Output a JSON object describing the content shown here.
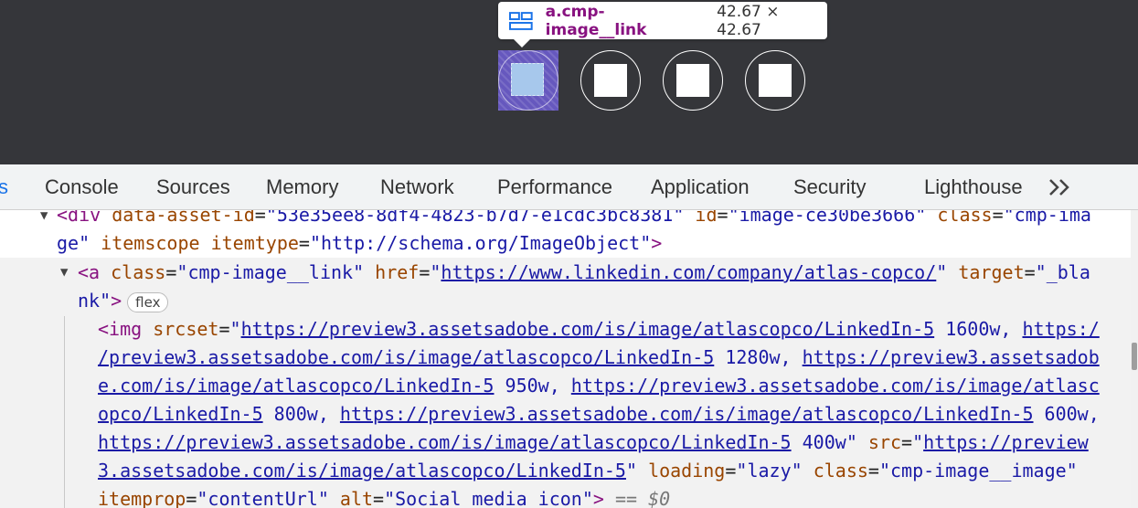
{
  "tooltip": {
    "selector": "a.cmp-image__link",
    "size": "42.67 × 42.67",
    "icon": "flex-layout-icon"
  },
  "preview": {
    "icons": [
      "linkedin-icon",
      "social-icon-2",
      "social-icon-3",
      "social-icon-4"
    ]
  },
  "tabs": {
    "partial": "s",
    "console": "Console",
    "sources": "Sources",
    "memory": "Memory",
    "network": "Network",
    "performance": "Performance",
    "application": "Application",
    "security": "Security",
    "lighthouse": "Lighthouse",
    "more": ">>"
  },
  "tree": {
    "l1": {
      "open": "<div",
      "a1n": "data-asset-id",
      "a1v": "\"53e35ee8-8df4-4823-b7d7-e1cdc3bc8381\"",
      "a2n": "id",
      "a2v": "\"image-ce30be3666\"",
      "a3n": "class",
      "a3v": "\"cmp-ima"
    },
    "l2": {
      "a3v_cont": "ge\"",
      "a4n": "itemscope",
      "a5n": "itemtype",
      "a5q1": "\"",
      "a5v": "http://schema.org/ImageObject",
      "a5q2": "\"",
      "close": ">"
    },
    "l3": {
      "open": "<a",
      "a1n": "class",
      "a1v": "\"cmp-image__link\"",
      "a2n": "href",
      "a2q1": "\"",
      "a2v": "https://www.linkedin.com/company/atlas-copco/",
      "a2q2": "\"",
      "a3n": "target",
      "a3v": "\"_bla"
    },
    "l4": {
      "a3v_cont": "nk\"",
      "close": ">",
      "badge": "flex"
    },
    "l5": {
      "open": "<img",
      "a1n": "srcset",
      "q": "\"",
      "link1": "https://preview3.assetsadobe.com/is/image/atlascopco/LinkedIn-5",
      "w1": " 1600w, ",
      "link2a": "https:/"
    },
    "l6": {
      "link2b": "/preview3.assetsadobe.com/is/image/atlascopco/LinkedIn-5",
      "w2": " 1280w, ",
      "link3a": "https://preview3.assetsadob"
    },
    "l7": {
      "link3b": "e.com/is/image/atlascopco/LinkedIn-5",
      "w3": " 950w, ",
      "link4a": "https://preview3.assetsadobe.com/is/image/atlasc"
    },
    "l8": {
      "link4b": "opco/LinkedIn-5",
      "w4": " 800w, ",
      "link5": "https://preview3.assetsadobe.com/is/image/atlascopco/LinkedIn-5",
      "w5": " 600w,"
    },
    "l9": {
      "link6": "https://preview3.assetsadobe.com/is/image/atlascopco/LinkedIn-5",
      "w6": " 400w",
      "q": "\"",
      "a2n": "src",
      "q2": "\"",
      "link7a": "https://preview"
    },
    "l10": {
      "link7b": "3.assetsadobe.com/is/image/atlascopco/LinkedIn-5",
      "q": "\"",
      "a3n": "loading",
      "a3v": "\"lazy\"",
      "a4n": "class",
      "a4v": "\"cmp-image__image\""
    },
    "l11": {
      "a5n": "itemprop",
      "a5v": "\"contentUrl\"",
      "a6n": "alt",
      "a6v": "\"Social media icon\"",
      "close": ">",
      "dollar": " == $0"
    }
  }
}
